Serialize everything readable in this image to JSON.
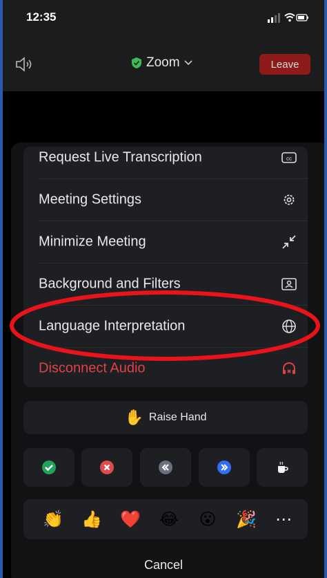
{
  "status_bar": {
    "time": "12:35"
  },
  "header": {
    "meeting_title": "Zoom",
    "leave_label": "Leave"
  },
  "menu": {
    "items": [
      {
        "label": "Request Live Transcription",
        "icon": "cc-icon"
      },
      {
        "label": "Meeting Settings",
        "icon": "gear-icon"
      },
      {
        "label": "Minimize Meeting",
        "icon": "minimize-arrows-icon"
      },
      {
        "label": "Background and Filters",
        "icon": "portrait-icon"
      },
      {
        "label": "Language Interpretation",
        "icon": "globe-icon"
      },
      {
        "label": "Disconnect Audio",
        "icon": "headphones-x-icon"
      }
    ]
  },
  "raise_hand": {
    "emoji": "✋",
    "label": "Raise Hand"
  },
  "reactions": [
    "check-icon",
    "x-icon",
    "rewind-icon",
    "fast-forward-icon",
    "coffee-icon"
  ],
  "emojis": [
    "👏",
    "👍",
    "❤️",
    "😂",
    "😮",
    "🎉",
    "⋯"
  ],
  "cancel_label": "Cancel",
  "colors": {
    "danger": "#e0424a",
    "highlight": "#e8141a",
    "check_green": "#22a35a",
    "x_red": "#e04a4a",
    "rewind_gray": "#6b6f80",
    "ff_blue": "#2f6ff0"
  }
}
